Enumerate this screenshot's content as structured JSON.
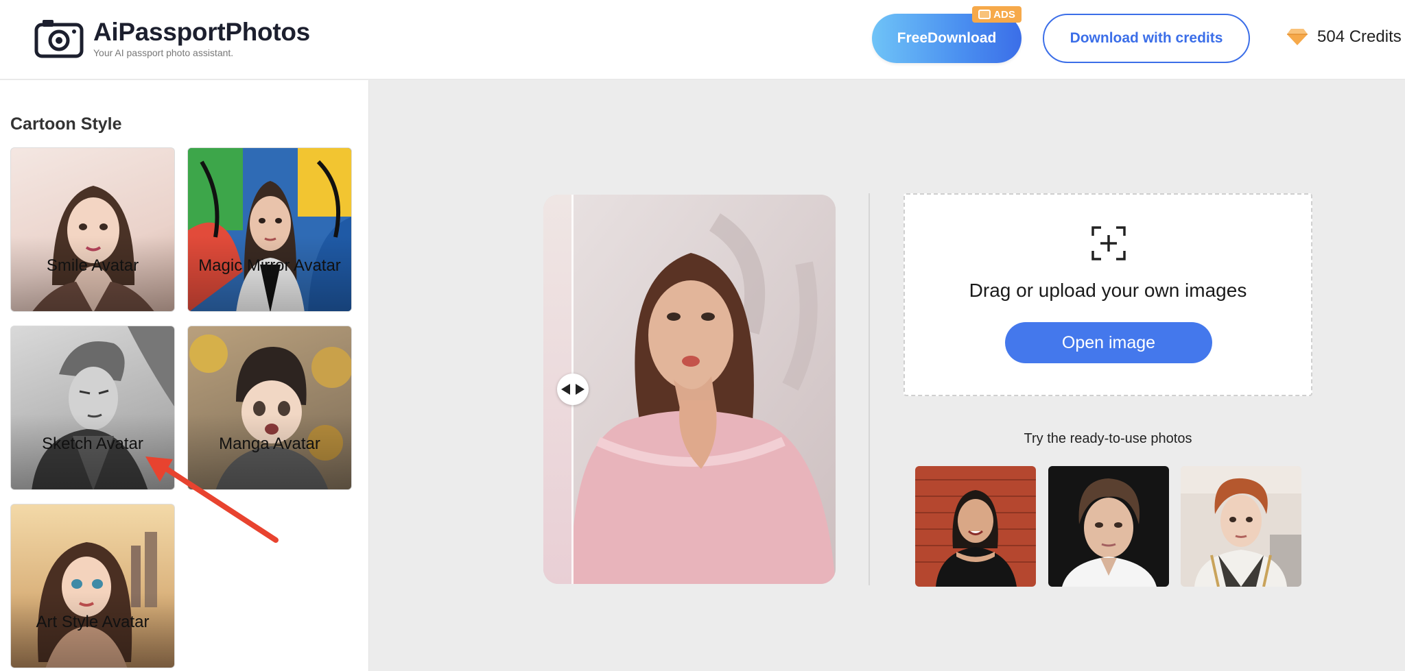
{
  "header": {
    "brand": "AiPassportPhotos",
    "tagline": "Your AI passport photo assistant.",
    "free_download_label": "FreeDownload",
    "ads_label": "ADS",
    "download_credits_label": "Download with credits",
    "credits_text": "504 Credits",
    "icons": [
      "camera-logo-icon",
      "tv-icon",
      "diamond-icon"
    ]
  },
  "sidebar": {
    "title": "Cartoon Style",
    "items": [
      {
        "label": "Smile Avatar"
      },
      {
        "label": "Magic Mirror Avatar"
      },
      {
        "label": "Sketch Avatar"
      },
      {
        "label": "Manga Avatar"
      },
      {
        "label": "Art Style Avatar"
      }
    ]
  },
  "main": {
    "upload_text": "Drag or upload your own images",
    "open_image_label": "Open image",
    "try_title": "Try the ready-to-use photos",
    "samples": [
      "sample-photo-woman",
      "sample-photo-man",
      "sample-photo-young-man"
    ]
  },
  "colors": {
    "accent": "#4478ec",
    "ads": "#f6a94a",
    "annotation_arrow": "#e8432f",
    "diamond": "#f6a94a"
  }
}
